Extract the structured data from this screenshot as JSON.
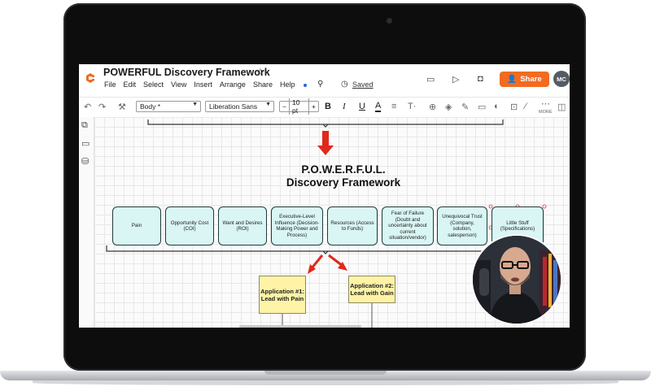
{
  "app": {
    "doc_title": "POWERFUL Discovery Framework",
    "menu": [
      "File",
      "Edit",
      "Select",
      "View",
      "Insert",
      "Arrange",
      "Share",
      "Help"
    ],
    "saved_label": "Saved",
    "share_label": "Share",
    "avatar_initials": "MC",
    "accent_color": "#f26b21"
  },
  "toolbar": {
    "style_value": "Body *",
    "font_value": "Liberation Sans",
    "font_size": "10 pt",
    "minus": "−",
    "plus": "+",
    "bold": "B",
    "italic": "I",
    "underline": "U",
    "text_color": "A",
    "more_label": "MORE"
  },
  "diagram": {
    "title_line1": "P.O.W.E.R.F.U.L.",
    "title_line2": "Discovery Framework",
    "stages": [
      "Pain",
      "Opportunity Cost (COI)",
      "Want and Desires (ROI)",
      "Executive-Level Influence (Decision-Making Power and Process)",
      "Resources (Access to Funds)",
      "Fear of Failure (Doubt and uncertainty about current situation/vendor)",
      "Unequivocal Trust (Company, solution, salesperson)",
      "Little Stuff (Specifications)"
    ],
    "applications": [
      "Application #1: Lead with Pain",
      "Application #2: Lead with Gain"
    ],
    "stage_color": "#d9f5f4",
    "application_color": "#fff3a6",
    "arrow_color": "#e0281c"
  }
}
